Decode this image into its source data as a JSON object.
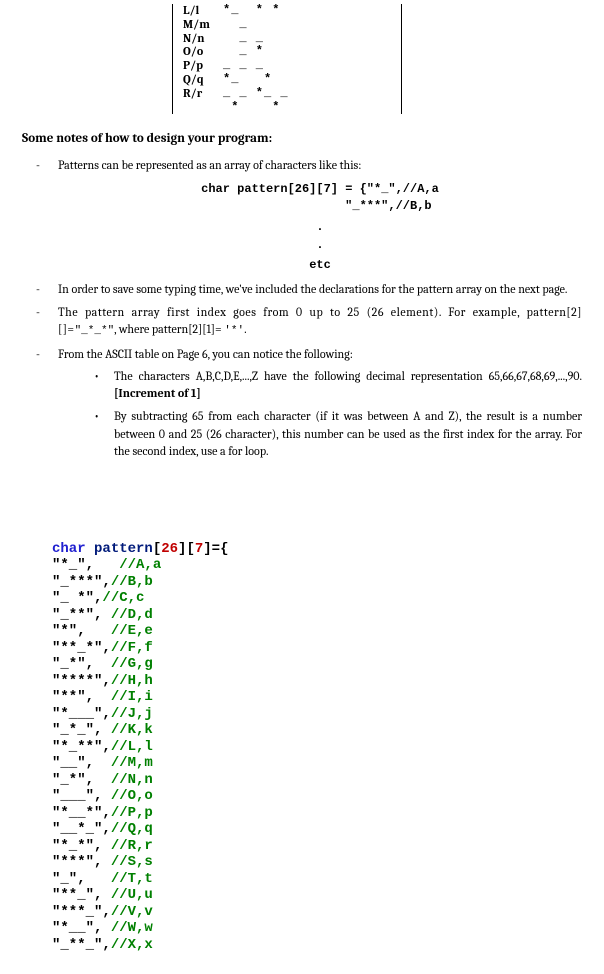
{
  "toprows": [
    {
      "label": "L/l",
      "pattern": "*_  * *"
    },
    {
      "label": "M/m",
      "pattern": "  _"
    },
    {
      "label": "N/n",
      "pattern": "  _ _"
    },
    {
      "label": "O/o",
      "pattern": "  _ *"
    },
    {
      "label": "P/p",
      "pattern": "_ _ _"
    },
    {
      "label": "Q/q",
      "pattern": "*_   *"
    },
    {
      "label": "R/r",
      "pattern": "_ _ *_ _"
    },
    {
      "label": "",
      "pattern": " *    *"
    }
  ],
  "heading_notes": "Some notes of how to design your program:",
  "bullets": {
    "b1": "Patterns can be represented as an array of characters like this:",
    "b2": "In order to save some typing time, we've included the declarations for the pattern array on the next page.",
    "b3_a": "The pattern array first index goes from 0 up to 25 (26 element). For example, pattern[2][]=",
    "b3_code1": "\"_*_*\"",
    "b3_b": ", where pattern[2][1]= ",
    "b3_code2": "'*'",
    "b3_c": ".",
    "b4": "From the ASCII table on Page 6, you can notice the following:",
    "sub1": "The characters A,B,C,D,E,...,Z have the following decimal representation 65,66,67,68,69,...,90. ",
    "sub1_bold": "[Increment of 1]",
    "sub2": "By subtracting 65 from each character (if it was between A and Z), the result is a number between 0 and 25 (26 character), this number can be used as the first index for the array. For the second index, use a for loop."
  },
  "snippet": {
    "lead": "char",
    "mid": " pattern[26][7] = {",
    "end": ",//A,a",
    "row2": "                    \"_***\",//B,b",
    "dot1": ".",
    "dot2": ".",
    "etc": "etc"
  },
  "code": {
    "kw_char": "char",
    "ident": " pattern",
    "br1": "26",
    "br2": "7",
    "after": "]={"
  },
  "code_lines": [
    {
      "lit": "\"*_\",   ",
      "cmt": "//A,a"
    },
    {
      "lit": "\"_***\",",
      "cmt": "//B,b"
    },
    {
      "lit": "\"_ *\",",
      "cmt": "//C,c"
    },
    {
      "lit": "\"_**\", ",
      "cmt": "//D,d"
    },
    {
      "lit": "\"*\",   ",
      "cmt": "//E,e"
    },
    {
      "lit": "\"**_*\",",
      "cmt": "//F,f"
    },
    {
      "lit": "\"_*\",  ",
      "cmt": "//G,g"
    },
    {
      "lit": "\"****\",",
      "cmt": "//H,h"
    },
    {
      "lit": "\"**\",  ",
      "cmt": "//I,i"
    },
    {
      "lit": "\"*___\",",
      "cmt": "//J,j"
    },
    {
      "lit": "\"_*_\", ",
      "cmt": "//K,k"
    },
    {
      "lit": "\"*_**\",",
      "cmt": "//L,l"
    },
    {
      "lit": "\"__\",  ",
      "cmt": "//M,m"
    },
    {
      "lit": "\"_*\",  ",
      "cmt": "//N,n"
    },
    {
      "lit": "\"___\", ",
      "cmt": "//O,o"
    },
    {
      "lit": "\"*__*\",",
      "cmt": "//P,p"
    },
    {
      "lit": "\"__*_\",",
      "cmt": "//Q,q"
    },
    {
      "lit": "\"*_*\", ",
      "cmt": "//R,r"
    },
    {
      "lit": "\"***\", ",
      "cmt": "//S,s"
    },
    {
      "lit": "\"_\",   ",
      "cmt": "//T,t"
    },
    {
      "lit": "\"**_\", ",
      "cmt": "//U,u"
    },
    {
      "lit": "\"***_\",",
      "cmt": "//V,v"
    },
    {
      "lit": "\"*__\", ",
      "cmt": "//W,w"
    },
    {
      "lit": "\"_**_\",",
      "cmt": "//X,x"
    }
  ]
}
